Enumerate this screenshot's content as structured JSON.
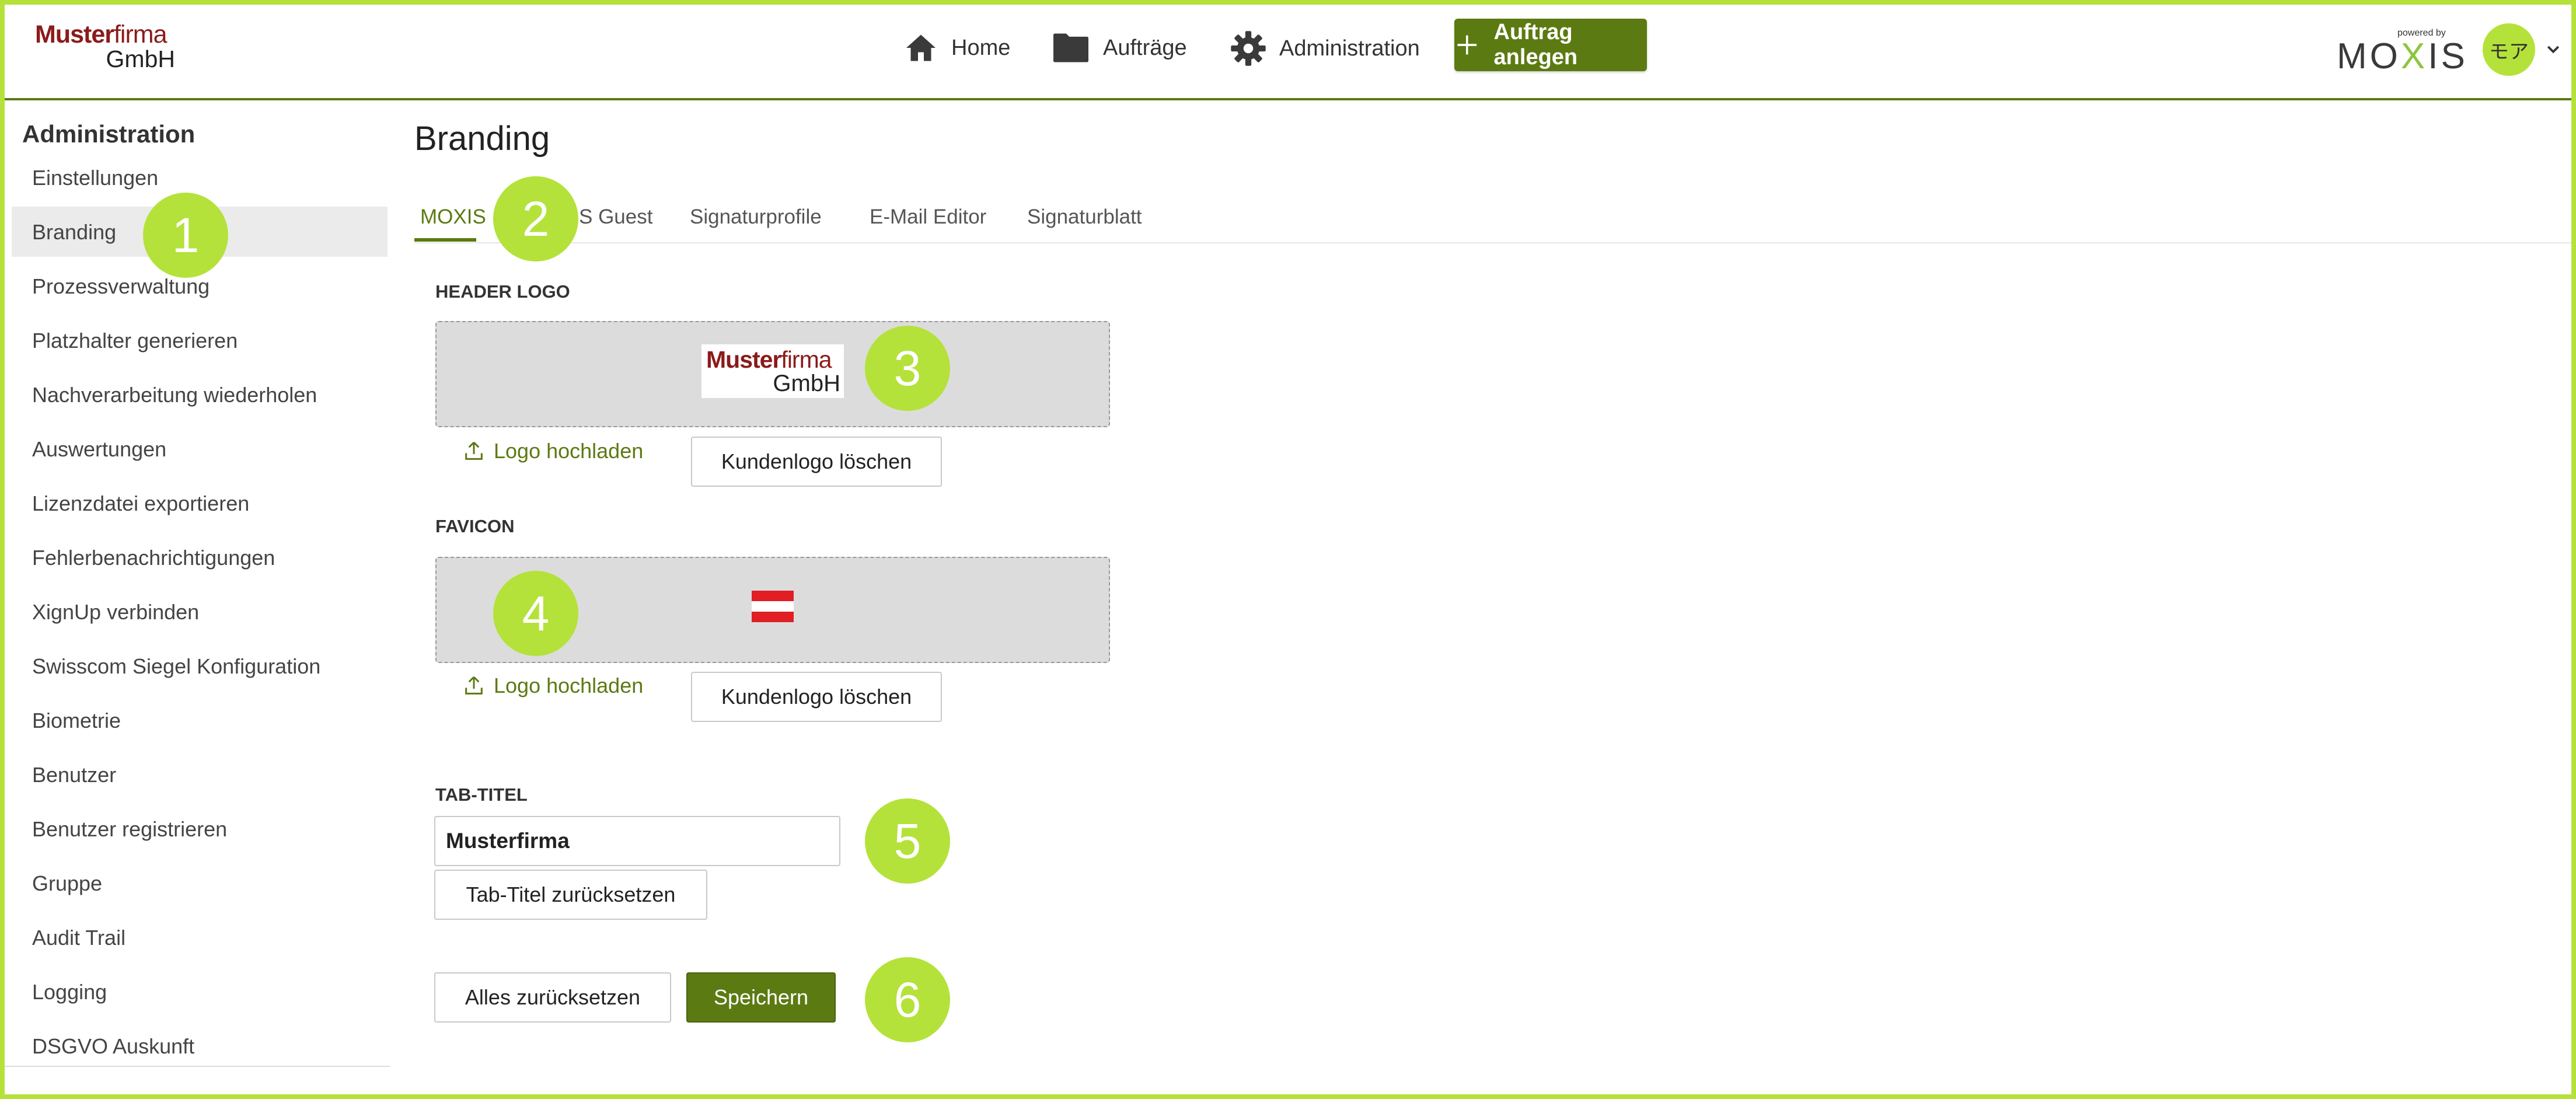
{
  "colors": {
    "accent": "#5c7a12",
    "callout": "#b4e23a",
    "brand_red": "#8b1a1a"
  },
  "header": {
    "company_logo": {
      "line1_bold": "Muster",
      "line1_light": "firma",
      "line2": "GmbH"
    },
    "nav": [
      {
        "label": "Home",
        "icon": "home-icon"
      },
      {
        "label": "Aufträge",
        "icon": "folder-icon"
      },
      {
        "label": "Administration",
        "icon": "gear-icon"
      }
    ],
    "new_order_button": {
      "label": "Auftrag anlegen",
      "icon": "plus-icon"
    },
    "product_logo": {
      "powered_by": "powered by",
      "word_left": "MO",
      "word_x": "X",
      "word_right": "IS"
    },
    "user": {
      "initials": "モア",
      "menu_icon": "chevron-down-icon"
    }
  },
  "sidebar": {
    "title": "Administration",
    "active_index": 1,
    "items": [
      "Einstellungen",
      "Branding",
      "Prozessverwaltung",
      "Platzhalter generieren",
      "Nachverarbeitung wiederholen",
      "Auswertungen",
      "Lizenzdatei exportieren",
      "Fehlerbenachrichtigungen",
      "XignUp verbinden",
      "Swisscom Siegel Konfiguration",
      "Biometrie",
      "Benutzer",
      "Benutzer registrieren",
      "Gruppe",
      "Audit Trail",
      "Logging",
      "DSGVO Auskunft"
    ]
  },
  "main": {
    "title": "Branding",
    "tabs": [
      {
        "label": "MOXIS",
        "active": true
      },
      {
        "label": "S Guest",
        "active": false
      },
      {
        "label": "Signaturprofile",
        "active": false
      },
      {
        "label": "E-Mail Editor",
        "active": false
      },
      {
        "label": "Signaturblatt",
        "active": false
      }
    ],
    "header_logo": {
      "label": "HEADER LOGO",
      "preview": {
        "line1_bold": "Muster",
        "line1_light": "firma",
        "line2": "GmbH"
      },
      "upload_label": "Logo hochladen",
      "delete_label": "Kundenlogo löschen"
    },
    "favicon": {
      "label": "FAVICON",
      "preview_icon": "austria-flag-icon",
      "upload_label": "Logo hochladen",
      "delete_label": "Kundenlogo löschen"
    },
    "tab_title": {
      "label": "TAB-TITEL",
      "value": "Musterfirma",
      "reset_label": "Tab-Titel zurücksetzen"
    },
    "reset_all_label": "Alles zurücksetzen",
    "save_label": "Speichern"
  },
  "callouts": [
    "1",
    "2",
    "3",
    "4",
    "5",
    "6"
  ]
}
